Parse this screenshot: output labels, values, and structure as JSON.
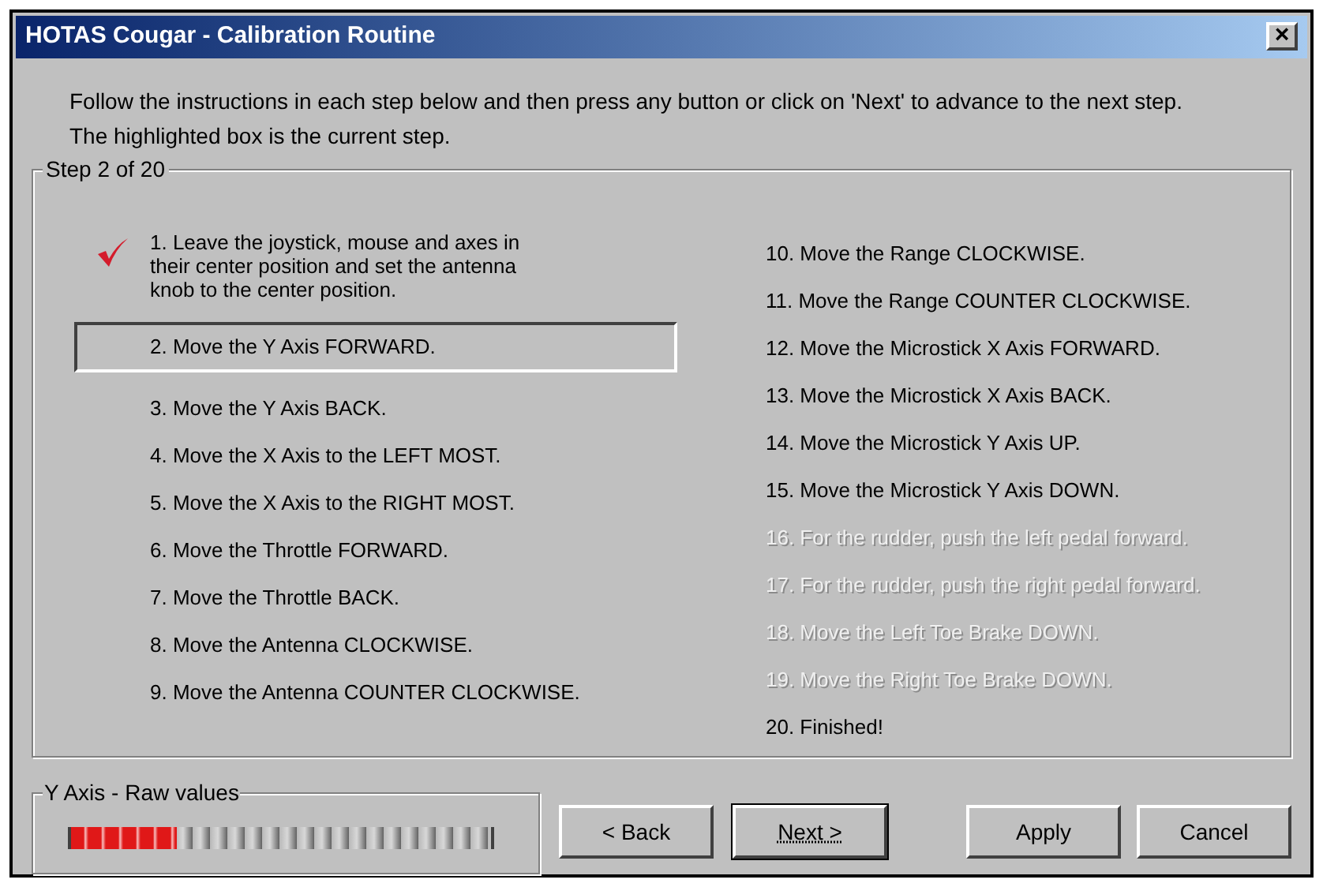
{
  "window": {
    "title": "HOTAS Cougar - Calibration Routine",
    "close": "×"
  },
  "instructions": [
    "Follow the instructions in each step below and then press any button or click on 'Next' to advance to the next step.",
    "The highlighted box is the current step."
  ],
  "steps_group": {
    "title": "Step 2 of 20"
  },
  "steps": [
    {
      "text": "1. Leave the joystick, mouse and axes in their center position and set the antenna knob to the center position.",
      "done": true,
      "selected": false,
      "disabled": false
    },
    {
      "text": "2. Move the Y Axis FORWARD.",
      "done": false,
      "selected": true,
      "disabled": false
    },
    {
      "text": "3. Move the Y Axis BACK.",
      "done": false,
      "selected": false,
      "disabled": false
    },
    {
      "text": "4. Move the X Axis to the LEFT MOST.",
      "done": false,
      "selected": false,
      "disabled": false
    },
    {
      "text": "5. Move the X Axis to the RIGHT MOST.",
      "done": false,
      "selected": false,
      "disabled": false
    },
    {
      "text": "6. Move the Throttle FORWARD.",
      "done": false,
      "selected": false,
      "disabled": false
    },
    {
      "text": "7. Move the Throttle BACK.",
      "done": false,
      "selected": false,
      "disabled": false
    },
    {
      "text": "8. Move the Antenna CLOCKWISE.",
      "done": false,
      "selected": false,
      "disabled": false
    },
    {
      "text": "9. Move the Antenna COUNTER CLOCKWISE.",
      "done": false,
      "selected": false,
      "disabled": false
    },
    {
      "text": "10. Move the Range CLOCKWISE.",
      "done": false,
      "selected": false,
      "disabled": false
    },
    {
      "text": "11. Move the Range COUNTER CLOCKWISE.",
      "done": false,
      "selected": false,
      "disabled": false
    },
    {
      "text": "12. Move the Microstick X Axis FORWARD.",
      "done": false,
      "selected": false,
      "disabled": false
    },
    {
      "text": "13. Move the Microstick X Axis BACK.",
      "done": false,
      "selected": false,
      "disabled": false
    },
    {
      "text": "14. Move the Microstick Y Axis UP.",
      "done": false,
      "selected": false,
      "disabled": false
    },
    {
      "text": "15. Move the Microstick Y Axis DOWN.",
      "done": false,
      "selected": false,
      "disabled": false
    },
    {
      "text": "16. For the rudder, push the left pedal forward.",
      "done": false,
      "selected": false,
      "disabled": true
    },
    {
      "text": "17. For the rudder, push the right pedal forward.",
      "done": false,
      "selected": false,
      "disabled": true
    },
    {
      "text": "18. Move the Left Toe Brake DOWN.",
      "done": false,
      "selected": false,
      "disabled": true
    },
    {
      "text": "19. Move the Right Toe Brake DOWN.",
      "done": false,
      "selected": false,
      "disabled": true
    },
    {
      "text": "20. Finished!",
      "done": false,
      "selected": false,
      "disabled": false
    }
  ],
  "raw_values": {
    "title": "Y Axis - Raw values",
    "level": 0.25
  },
  "buttons": [
    {
      "label": "< Back",
      "focused": false
    },
    {
      "label": "Next >",
      "focused": true
    },
    {
      "label": "Apply",
      "focused": false
    },
    {
      "label": "Cancel",
      "focused": false
    }
  ]
}
